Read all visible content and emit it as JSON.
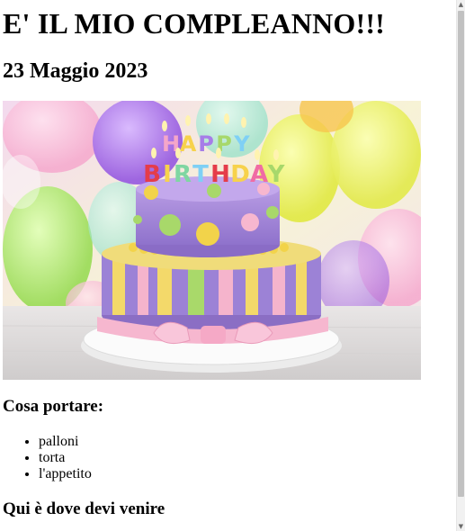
{
  "page": {
    "title": "E' IL MIO COMPLEANNO!!!",
    "date": "23 Maggio 2023",
    "hero_image": {
      "banner_letters": [
        "H",
        "A",
        "P",
        "P",
        "Y",
        "B",
        "I",
        "R",
        "T",
        "H",
        "D",
        "A",
        "Y"
      ],
      "colors": {
        "cake_top": "#a78bd6",
        "cake_bottom": "#9b7fd4",
        "ribbon": "#f5b4cc",
        "plate": "#f4f4f4",
        "balloon_yellow": "#e8ef55",
        "balloon_purple": "#a36fe0",
        "balloon_green": "#a7e06b"
      }
    },
    "bring_section": {
      "heading": "Cosa portare:",
      "items": [
        "palloni",
        "torta",
        "l'appetito"
      ]
    },
    "location_section": {
      "heading": "Qui è dove devi venire"
    }
  },
  "scrollbar": {
    "up_glyph": "▲",
    "down_glyph": "▼"
  }
}
